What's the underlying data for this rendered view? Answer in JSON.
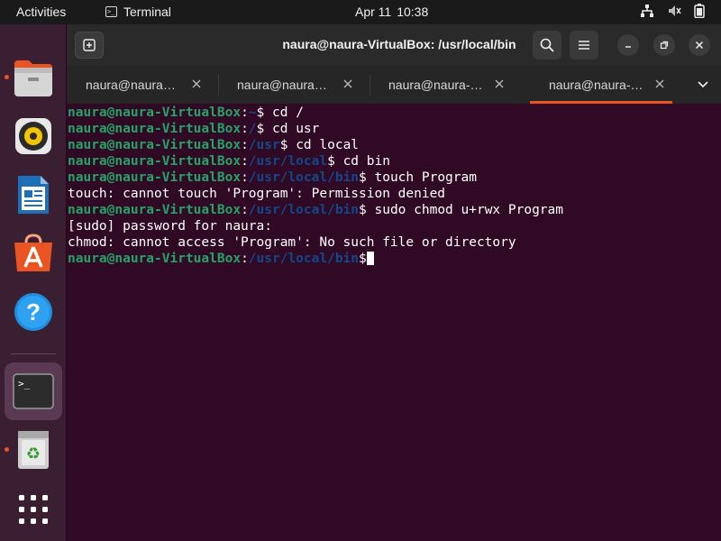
{
  "topbar": {
    "activities": "Activities",
    "app_name": "Terminal",
    "app_icon_glyph": ">_",
    "date": "Apr 11",
    "time": "10:38",
    "tray_icons": [
      "network-icon",
      "volume-muted-icon",
      "battery-icon"
    ]
  },
  "dock": {
    "items": [
      {
        "name": "files",
        "icon": "files-icon",
        "running": true
      },
      {
        "name": "rhythmbox",
        "icon": "rhythmbox-icon",
        "running": false
      },
      {
        "name": "writer",
        "icon": "libreoffice-writer-icon",
        "running": false
      },
      {
        "name": "software",
        "icon": "ubuntu-software-icon",
        "running": false
      },
      {
        "name": "help",
        "icon": "help-icon",
        "running": false
      },
      {
        "name": "terminal",
        "icon": "terminal-icon",
        "running": true,
        "active": true
      },
      {
        "name": "trash",
        "icon": "trash-icon",
        "running": true
      },
      {
        "name": "show-apps",
        "icon": "app-grid-icon",
        "running": false
      }
    ],
    "terminal_glyph": ">_"
  },
  "window": {
    "title": "naura@naura-VirtualBox: /usr/local/bin",
    "tabs": [
      {
        "label": "naura@naura…",
        "active": false
      },
      {
        "label": "naura@naura…",
        "active": false
      },
      {
        "label": "naura@naura-…",
        "active": false
      },
      {
        "label": "naura@naura-…",
        "active": true
      }
    ]
  },
  "terminal": {
    "user_host": "naura@naura-VirtualBox",
    "lines": [
      {
        "type": "prompt",
        "path": "~",
        "command": "cd /"
      },
      {
        "type": "prompt",
        "path": "/",
        "command": "cd usr"
      },
      {
        "type": "prompt",
        "path": "/usr",
        "command": "cd local"
      },
      {
        "type": "prompt",
        "path": "/usr/local",
        "command": "cd bin"
      },
      {
        "type": "prompt",
        "path": "/usr/local/bin",
        "command": "touch Program"
      },
      {
        "type": "output",
        "text": "touch: cannot touch 'Program': Permission denied"
      },
      {
        "type": "prompt",
        "path": "/usr/local/bin",
        "command": "sudo chmod u+rwx Program"
      },
      {
        "type": "output",
        "text": "[sudo] password for naura:"
      },
      {
        "type": "output",
        "text": "chmod: cannot access 'Program': No such file or directory"
      },
      {
        "type": "prompt",
        "path": "/usr/local/bin",
        "command": "",
        "cursor": true
      }
    ]
  },
  "colors": {
    "terminal_bg": "#300a24",
    "user_host": "#26a269",
    "path": "#12488b",
    "accent": "#e95420"
  }
}
